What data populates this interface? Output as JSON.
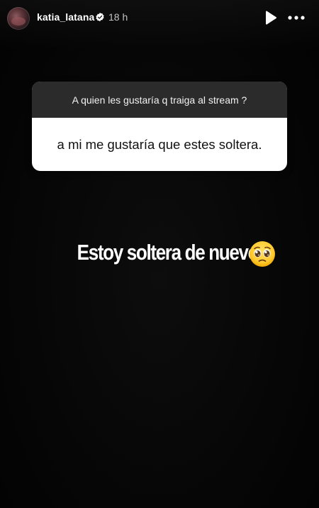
{
  "header": {
    "username": "katia_latana",
    "time": "18 h",
    "verified_color": "#ffffff"
  },
  "question_sticker": {
    "question": "A quien les gustaría q traiga al stream ?",
    "answer": "a mi me gustaría que estes soltera."
  },
  "caption": {
    "text": "Estoy soltera de nuevo",
    "emoji": "pleading-face-icon"
  },
  "colors": {
    "background": "#050505",
    "sticker_header": "#2b2b2b",
    "sticker_body": "#ffffff"
  }
}
